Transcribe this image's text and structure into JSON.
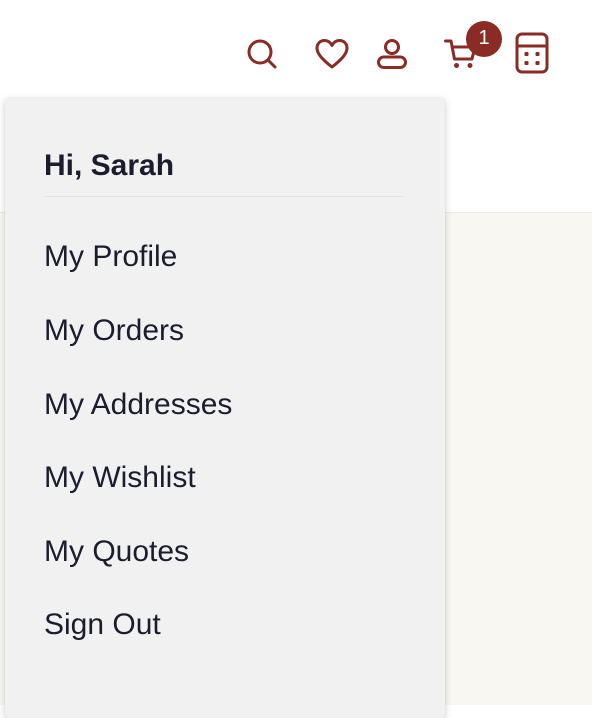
{
  "header": {
    "icons": {
      "search": "search-icon",
      "wishlist": "heart-icon",
      "account": "user-icon",
      "cart": "cart-icon",
      "calculator": "calculator-icon"
    },
    "cart_count": "1",
    "accent_color": "#8a2b26"
  },
  "account_menu": {
    "greeting": "Hi, Sarah",
    "items": [
      {
        "label": "My Profile"
      },
      {
        "label": "My Orders"
      },
      {
        "label": "My Addresses"
      },
      {
        "label": "My Wishlist"
      },
      {
        "label": "My Quotes"
      },
      {
        "label": "Sign Out"
      }
    ]
  },
  "colors": {
    "menu_background": "#f1f1f1",
    "text": "#1b1c2e",
    "page_background": "#f9f7f1"
  }
}
